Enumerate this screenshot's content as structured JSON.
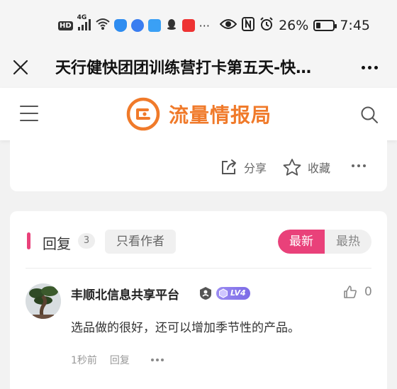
{
  "status_bar": {
    "network_hd": "HD",
    "network_gen": "4G",
    "battery_percent": "26%",
    "battery_level": 0.26,
    "time": "7:45",
    "overflow": "···"
  },
  "title_bar": {
    "title": "天行健快团团训练营打卡第五天-快…"
  },
  "site_header": {
    "logo_text": "流量情报局",
    "brand_color": "#f07a2a"
  },
  "post_actions": {
    "share_label": "分享",
    "favorite_label": "收藏"
  },
  "replies": {
    "title": "回复",
    "count": "3",
    "author_only_label": "只看作者",
    "sort_options": [
      "最新",
      "最热"
    ],
    "sort_selected": "最新",
    "accent_color": "#e9417a"
  },
  "comment": {
    "user_name": "丰顺北信息共享平台",
    "level": "LV4",
    "like_count": "0",
    "text": "选品做的很好，还可以增加季节性的产品。",
    "time": "1秒前",
    "reply_label": "回复"
  }
}
